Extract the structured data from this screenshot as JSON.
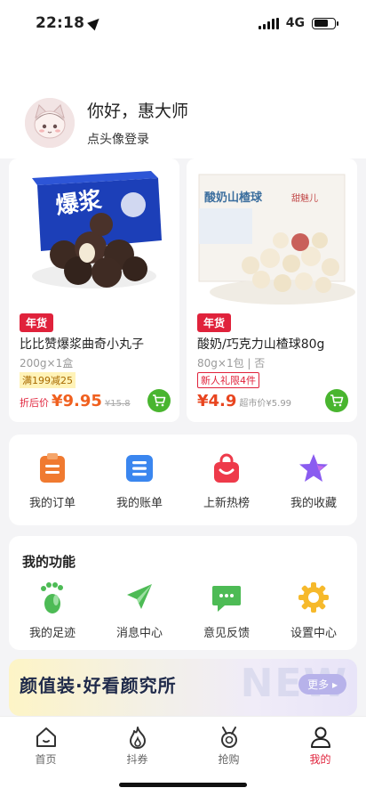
{
  "status_bar": {
    "time": "22:18",
    "network": "4G"
  },
  "header": {
    "greeting": "你好，惠大师",
    "login_prompt": "点头像登录"
  },
  "products": [
    {
      "tag": "年货",
      "name": "比比赞爆浆曲奇小丸子",
      "spec": "200g×1盒",
      "promo": "满199减25",
      "price_label": "折后价",
      "price": "¥9.95",
      "original_price": "¥15.8"
    },
    {
      "tag": "年货",
      "name": "酸奶/巧克力山楂球80g",
      "spec": "80g×1包 | 否",
      "promo": "新人礼限4件",
      "price": "¥4.9",
      "market_price": "超市价¥5.99"
    }
  ],
  "orders": {
    "items": [
      {
        "label": "我的订单",
        "icon": "clipboard-icon"
      },
      {
        "label": "我的账单",
        "icon": "bill-icon"
      },
      {
        "label": "上新热榜",
        "icon": "shopping-bag-icon"
      },
      {
        "label": "我的收藏",
        "icon": "star-icon"
      }
    ]
  },
  "functions": {
    "title": "我的功能",
    "items": [
      {
        "label": "我的足迹",
        "icon": "footprint-icon"
      },
      {
        "label": "消息中心",
        "icon": "send-icon"
      },
      {
        "label": "意见反馈",
        "icon": "chat-icon"
      },
      {
        "label": "设置中心",
        "icon": "gear-icon"
      }
    ]
  },
  "banner": {
    "title": "颜值装·好看颜究所",
    "more": "更多",
    "watermark": "NEW"
  },
  "tabbar": {
    "items": [
      {
        "label": "首页",
        "icon": "home-icon"
      },
      {
        "label": "抖券",
        "icon": "flame-icon"
      },
      {
        "label": "抢购",
        "icon": "medal-icon"
      },
      {
        "label": "我的",
        "icon": "user-icon"
      }
    ],
    "active": "我的"
  },
  "colors": {
    "accent_red": "#e0223b",
    "price_orange": "#f0601f",
    "cart_green": "#49b52f",
    "order_orange": "#f07a30",
    "bill_blue": "#3a86ef",
    "bag_red": "#ee3a4a",
    "star_purple": "#8a5cf0",
    "func_green": "#4dbb55"
  }
}
